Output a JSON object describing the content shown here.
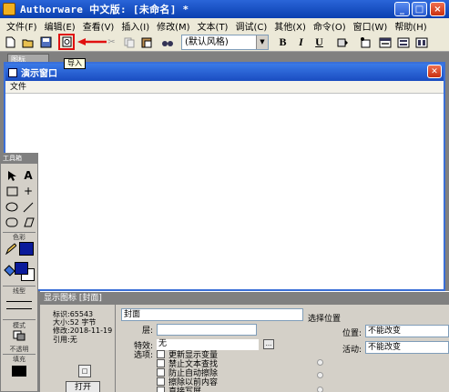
{
  "window": {
    "title": "Authorware 中文版: [未命名] *",
    "minimize": "_",
    "maximize": "□",
    "close": "×"
  },
  "menu": [
    "文件(F)",
    "编辑(E)",
    "查看(V)",
    "插入(I)",
    "修改(M)",
    "文本(T)",
    "调试(C)",
    "其他(X)",
    "命令(O)",
    "窗口(W)",
    "帮助(H)"
  ],
  "toolbar": {
    "style_select": "(默认风格)",
    "bold": "B",
    "italic": "I",
    "underline": "U",
    "import_tooltip": "导入"
  },
  "background_tab": "图标",
  "presentation": {
    "title": "演示窗口",
    "menu_file": "文件"
  },
  "palette": {
    "title": "工具箱",
    "color_label": "色彩",
    "line_label": "线型",
    "mode_label": "模式",
    "mode_value": "不透明",
    "fill_label": "填充",
    "accent": "#0a1a9a"
  },
  "props": {
    "title": "显示图标 [封面]",
    "id": "标识:65543",
    "size": "大小:52 字节",
    "modified": "修改:2018-11-19",
    "ref": "引用:无",
    "open_button": "打开",
    "name": "封面",
    "layer_label": "层:",
    "effect_label": "特效:",
    "effect_value": "无",
    "effect_more": "...",
    "options_label": "选项:",
    "options": [
      "更新显示变量",
      "禁止文本查找",
      "防止自动擦除",
      "擦除以前内容",
      "直接写屏"
    ],
    "position_header": "选择位置",
    "position_label": "位置:",
    "position_value": "不能改变",
    "activity_label": "活动:",
    "activity_value": "不能改变"
  }
}
